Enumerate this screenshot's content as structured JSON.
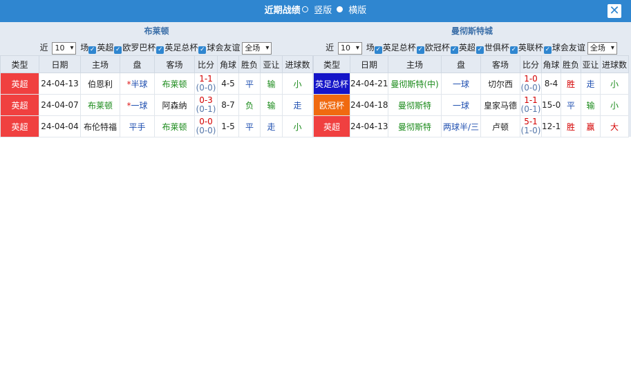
{
  "title": {
    "text": "近期战绩",
    "opt_vertical": "竖版",
    "opt_horizontal": "横版",
    "close": "✕"
  },
  "colors": {
    "header_bg": "#2f86d0",
    "epl": "#f04040",
    "efl_cup": "#1515c8",
    "ucl": "#f06a10"
  },
  "left": {
    "team": "布莱顿",
    "filters": {
      "near": "近",
      "count": "10",
      "unit": "场",
      "checks": [
        "英超",
        "欧罗巴杯",
        "英足总杯",
        "球会友谊"
      ],
      "scope": "全场"
    },
    "headers": [
      "类型",
      "日期",
      "主场",
      "盘",
      "客场",
      "比分",
      "角球",
      "胜负",
      "亚让",
      "进球数"
    ],
    "rows": [
      {
        "league": "英超",
        "league_color": "#f04040",
        "date": "24-04-13",
        "home": "伯恩利",
        "home_cls": "dk",
        "star": "*",
        "hcp": "半球",
        "hcp_cls": "b",
        "away": "布莱顿",
        "away_cls": "g",
        "score": "1-1",
        "half": "(0-0)",
        "corners": "4-5",
        "wl": "平",
        "wl_cls": "b",
        "ah": "输",
        "ah_cls": "g",
        "ou": "小",
        "ou_cls": "g"
      },
      {
        "league": "英超",
        "league_color": "#f04040",
        "date": "24-04-07",
        "home": "布莱顿",
        "home_cls": "g",
        "star": "*",
        "hcp": "一球",
        "hcp_cls": "b",
        "away": "阿森纳",
        "away_cls": "dk",
        "score": "0-3",
        "half": "(0-1)",
        "corners": "8-7",
        "wl": "负",
        "wl_cls": "g",
        "ah": "输",
        "ah_cls": "g",
        "ou": "走",
        "ou_cls": "b"
      },
      {
        "league": "英超",
        "league_color": "#f04040",
        "date": "24-04-04",
        "home": "布伦特福",
        "home_cls": "dk",
        "star": "",
        "hcp": "平手",
        "hcp_cls": "b",
        "away": "布莱顿",
        "away_cls": "g",
        "score": "0-0",
        "half": "(0-0)",
        "corners": "1-5",
        "wl": "平",
        "wl_cls": "b",
        "ah": "走",
        "ah_cls": "b",
        "ou": "小",
        "ou_cls": "g"
      }
    ]
  },
  "right": {
    "team": "曼彻斯特城",
    "filters": {
      "near": "近",
      "count": "10",
      "unit": "场",
      "checks": [
        "英足总杯",
        "欧冠杯",
        "英超",
        "世俱杯",
        "英联杯",
        "球会友谊"
      ],
      "scope": "全场"
    },
    "headers": [
      "类型",
      "日期",
      "主场",
      "盘",
      "客场",
      "比分",
      "角球",
      "胜负",
      "亚让",
      "进球数"
    ],
    "rows": [
      {
        "league": "英足总杯",
        "league_color": "#1515c8",
        "date": "24-04-21",
        "home": "曼彻斯特(中)",
        "home_cls": "g",
        "star": "",
        "hcp": "一球",
        "hcp_cls": "b",
        "away": "切尔西",
        "away_cls": "dk",
        "score": "1-0",
        "half": "(0-0)",
        "corners": "8-4",
        "wl": "胜",
        "wl_cls": "r",
        "ah": "走",
        "ah_cls": "b",
        "ou": "小",
        "ou_cls": "g"
      },
      {
        "league": "欧冠杯",
        "league_color": "#f06a10",
        "date": "24-04-18",
        "home": "曼彻斯特",
        "home_cls": "g",
        "star": "",
        "hcp": "一球",
        "hcp_cls": "b",
        "away": "皇家马德",
        "away_cls": "dk",
        "score": "1-1",
        "half": "(0-1)",
        "corners": "15-0",
        "wl": "平",
        "wl_cls": "b",
        "ah": "输",
        "ah_cls": "g",
        "ou": "小",
        "ou_cls": "g"
      },
      {
        "league": "英超",
        "league_color": "#f04040",
        "date": "24-04-13",
        "home": "曼彻斯特",
        "home_cls": "g",
        "star": "",
        "hcp": "两球半/三",
        "hcp_cls": "b",
        "away": "卢顿",
        "away_cls": "dk",
        "score": "5-1",
        "half": "(1-0)",
        "corners": "12-1",
        "wl": "胜",
        "wl_cls": "r",
        "ah": "赢",
        "ah_cls": "r",
        "ou": "大",
        "ou_cls": "r"
      }
    ]
  }
}
